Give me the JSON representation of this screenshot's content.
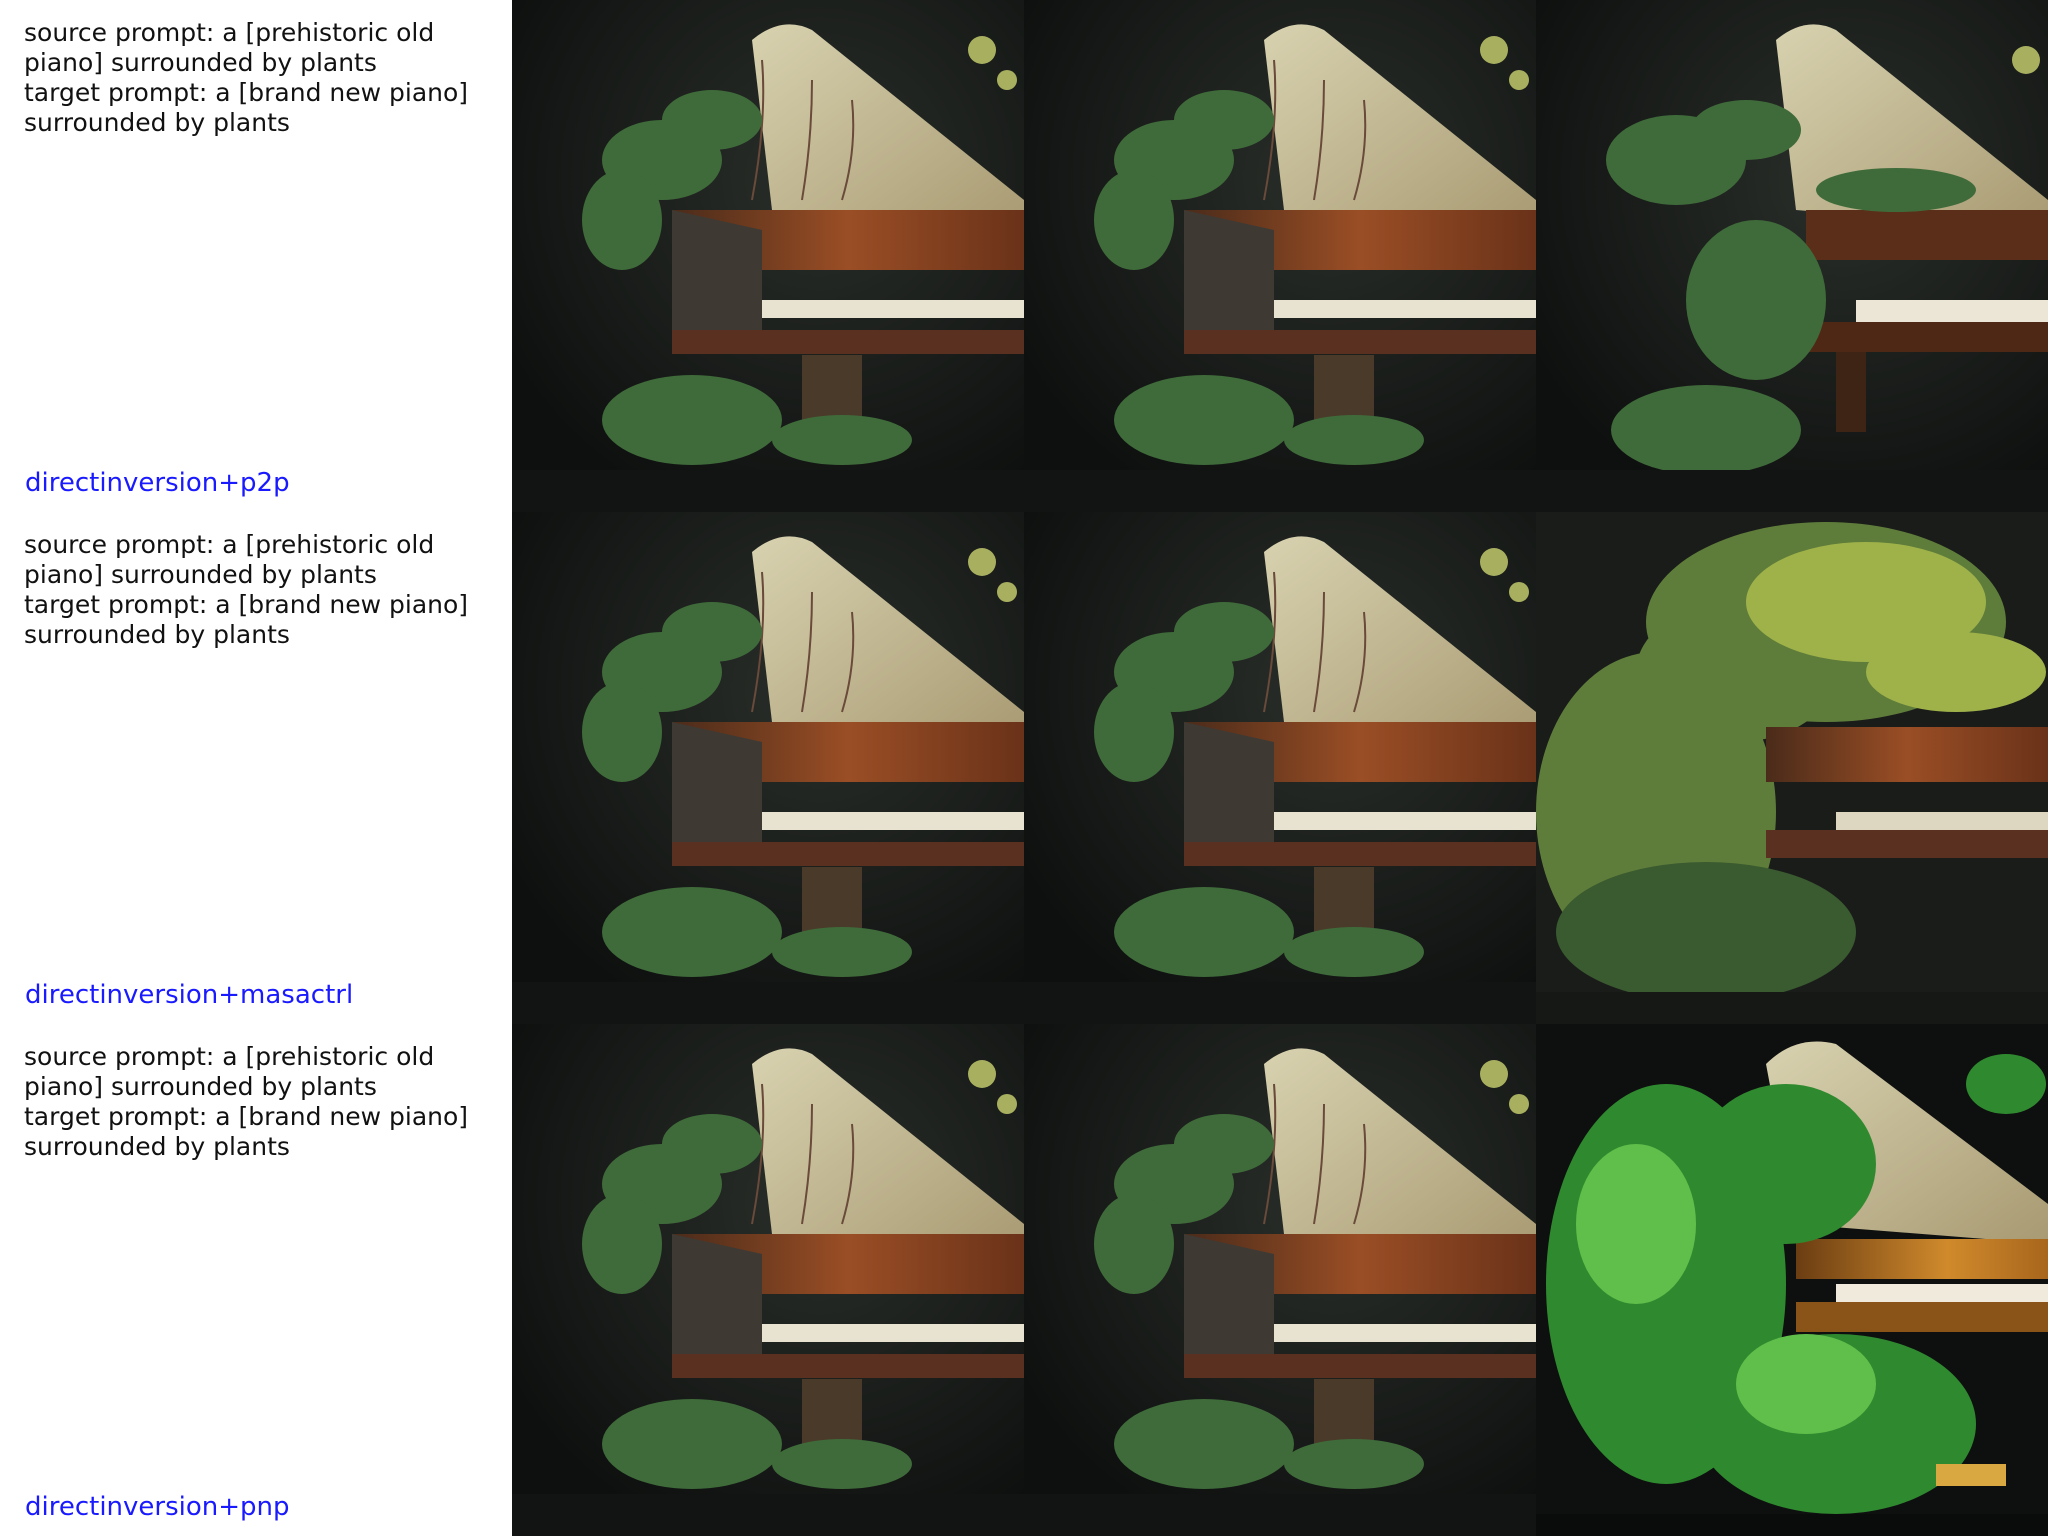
{
  "rows": [
    {
      "prompt_lines": "source prompt: a [prehistoric old\npiano] surrounded by plants\ntarget prompt: a [brand new piano]\nsurrounded by plants",
      "method": "directinversion+p2p",
      "images": [
        "source-image",
        "reconstructed-image",
        "edited-image"
      ]
    },
    {
      "prompt_lines": "source prompt: a [prehistoric old\npiano] surrounded by plants\ntarget prompt: a [brand new piano]\nsurrounded by plants",
      "method": "directinversion+masactrl",
      "images": [
        "source-image",
        "reconstructed-image",
        "edited-image"
      ]
    },
    {
      "prompt_lines": "source prompt: a [prehistoric old\npiano] surrounded by plants\ntarget prompt: a [brand new piano]\nsurrounded by plants",
      "method": "directinversion+pnp",
      "images": [
        "source-image",
        "reconstructed-image",
        "edited-image"
      ]
    }
  ],
  "colors": {
    "method_label": "#1a1aff",
    "prompt_text": "#111111",
    "image_background": "#141614",
    "piano_wood": "#7a3d1f",
    "foliage": "#3f6b3a"
  }
}
